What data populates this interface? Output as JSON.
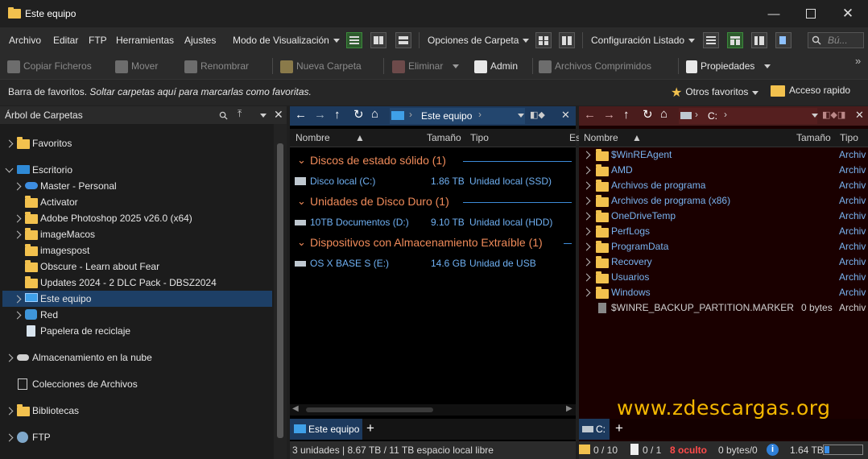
{
  "window": {
    "title": "Este equipo"
  },
  "menu": {
    "items": [
      "Archivo",
      "Editar",
      "FTP",
      "Herramientas",
      "Ajustes"
    ],
    "view_mode": "Modo de Visualización",
    "folder_options": "Opciones de Carpeta",
    "list_config": "Configuración Listado",
    "search_placeholder": "Bú..."
  },
  "toolbar": {
    "copy": "Copiar Ficheros",
    "move": "Mover",
    "rename": "Renombrar",
    "new_folder": "Nueva Carpeta",
    "delete": "Eliminar",
    "admin": "Admin",
    "compressed": "Archivos Comprimidos",
    "properties": "Propiedades"
  },
  "favbar": {
    "label": "Barra de favoritos.",
    "hint": "Soltar carpetas aquí para marcarlas como favoritas.",
    "other_favorites": "Otros favoritos",
    "quick_access": "Acceso rapido"
  },
  "tree": {
    "header": "Árbol de Carpetas",
    "items": [
      {
        "label": "Favoritos"
      },
      {
        "label": "Escritorio"
      },
      {
        "label": "Master - Personal"
      },
      {
        "label": "Activator"
      },
      {
        "label": "Adobe Photoshop 2025 v26.0 (x64)"
      },
      {
        "label": "imageMacos"
      },
      {
        "label": "imagespost"
      },
      {
        "label": "Obscure - Learn about Fear"
      },
      {
        "label": "Updates 2024 - 2 DLC Pack - DBSZ2024"
      },
      {
        "label": "Este equipo"
      },
      {
        "label": "Red"
      },
      {
        "label": "Papelera de reciclaje"
      },
      {
        "label": "Almacenamiento en la nube"
      },
      {
        "label": "Colecciones de Archivos"
      },
      {
        "label": "Bibliotecas"
      },
      {
        "label": "FTP"
      }
    ]
  },
  "left_pane": {
    "path": "Este equipo",
    "columns": [
      "Nombre",
      "Tamaño",
      "Tipo",
      "Es"
    ],
    "groups": [
      {
        "title": "Discos de estado sólido (1)",
        "drives": [
          {
            "name": "Disco local (C:)",
            "size": "1.86 TB",
            "type": "Unidad local (SSD)"
          }
        ]
      },
      {
        "title": "Unidades de Disco Duro (1)",
        "drives": [
          {
            "name": "10TB Documentos (D:)",
            "size": "9.10 TB",
            "type": "Unidad local (HDD)"
          }
        ]
      },
      {
        "title": "Dispositivos con Almacenamiento Extraíble (1)",
        "drives": [
          {
            "name": "OS X BASE S (E:)",
            "size": "14.6 GB",
            "type": "Unidad de USB"
          }
        ]
      }
    ],
    "tab": "Este equipo",
    "status": "3 unidades | 8.67 TB / 11 TB espacio local libre"
  },
  "right_pane": {
    "path": "C:",
    "columns": [
      "Nombre",
      "Tamaño",
      "Tipo"
    ],
    "rows": [
      {
        "name": "$WinREAgent",
        "size": "",
        "type": "Archiv"
      },
      {
        "name": "AMD",
        "size": "",
        "type": "Archiv"
      },
      {
        "name": "Archivos de programa",
        "size": "",
        "type": "Archiv"
      },
      {
        "name": "Archivos de programa (x86)",
        "size": "",
        "type": "Archiv"
      },
      {
        "name": "OneDriveTemp",
        "size": "",
        "type": "Archiv"
      },
      {
        "name": "PerfLogs",
        "size": "",
        "type": "Archiv"
      },
      {
        "name": "ProgramData",
        "size": "",
        "type": "Archiv"
      },
      {
        "name": "Recovery",
        "size": "",
        "type": "Archiv"
      },
      {
        "name": "Usuarios",
        "size": "",
        "type": "Archiv"
      },
      {
        "name": "Windows",
        "size": "",
        "type": "Archiv"
      },
      {
        "name": "$WINRE_BACKUP_PARTITION.MARKER",
        "size": "0 bytes",
        "type": "Archiv"
      }
    ],
    "tab": "C:",
    "status": {
      "folders": "0 / 10",
      "files": "0 / 1",
      "hidden": "8 oculto",
      "bytes": "0 bytes/0",
      "drive": "1.64 TB"
    }
  },
  "watermark": "www.zdescargas.org",
  "colors": {
    "left_path_bg": "#1d3a5e",
    "right_path_bg": "#4a1c1c",
    "right_pane_bg": "#1a0000",
    "group_title": "#f08b5a",
    "link_blue": "#79b3f0",
    "hidden_red": "#ff4a4a"
  }
}
